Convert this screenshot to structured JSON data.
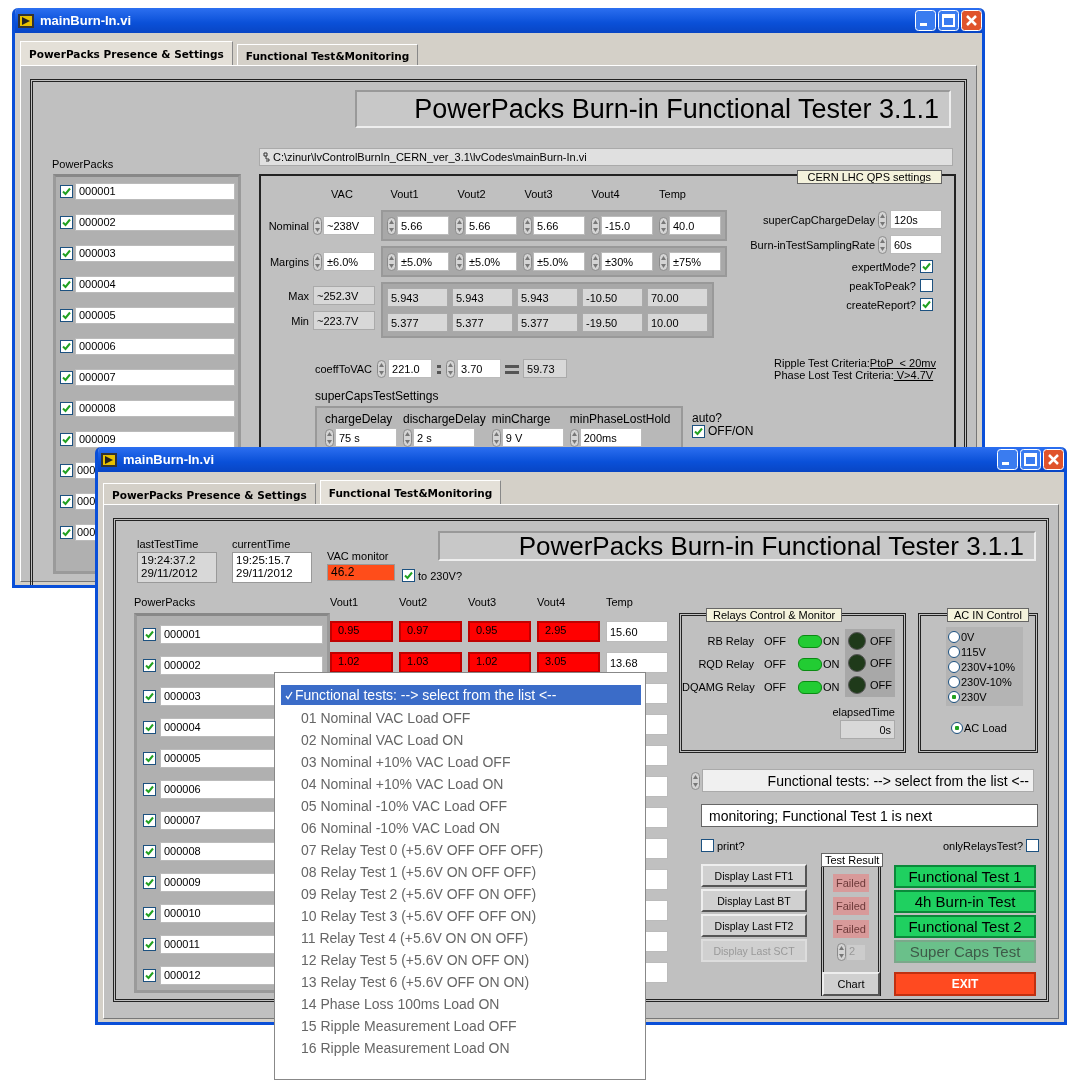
{
  "back_window": {
    "title": "mainBurn-In.vi",
    "tabs": [
      {
        "label": "PowerPacks Presence & Settings",
        "selected": true
      },
      {
        "label": "Functional Test&Monitoring",
        "selected": false
      }
    ],
    "heading": "PowerPacks Burn-in Functional Tester 3.1.1",
    "path": "C:\\zinur\\lvControlBurnIn_CERN_ver_3.1\\lvCodes\\mainBurn-In.vi",
    "powerpacks_label": "PowerPacks",
    "powerpacks": [
      {
        "id": "000001",
        "checked": true
      },
      {
        "id": "000002",
        "checked": true
      },
      {
        "id": "000003",
        "checked": true
      },
      {
        "id": "000004",
        "checked": true
      },
      {
        "id": "000005",
        "checked": true
      },
      {
        "id": "000006",
        "checked": true
      },
      {
        "id": "000007",
        "checked": true
      },
      {
        "id": "000008",
        "checked": true
      },
      {
        "id": "000009",
        "checked": true
      },
      {
        "id": "000",
        "checked": true
      },
      {
        "id": "000",
        "checked": true
      },
      {
        "id": "000",
        "checked": true
      }
    ],
    "settings_label": "CERN LHC QPS settings",
    "columns": [
      "VAC",
      "Vout1",
      "Vout2",
      "Vout3",
      "Vout4",
      "Temp"
    ],
    "input_rows": [
      {
        "label": "Nominal",
        "values": [
          "~238V",
          "5.66",
          "5.66",
          "5.66",
          "-15.0",
          "40.0"
        ]
      },
      {
        "label": "Margins",
        "values": [
          "±6.0%",
          "±5.0%",
          "±5.0%",
          "±5.0%",
          "±30%",
          "±75%"
        ]
      }
    ],
    "limit_rows": [
      {
        "label": "Max",
        "values": [
          "~252.3V",
          "5.943",
          "5.943",
          "5.943",
          "-10.50",
          "70.00"
        ]
      },
      {
        "label": "Min",
        "values": [
          "~223.7V",
          "5.377",
          "5.377",
          "5.377",
          "-19.50",
          "10.00"
        ]
      }
    ],
    "coeff": {
      "label": "coeffToVAC",
      "a": "221.0",
      "b": "3.70",
      "result": "59.73"
    },
    "supercaps": {
      "label": "superCapsTestSettings",
      "fields": [
        {
          "label": "chargeDelay",
          "value": "75 s"
        },
        {
          "label": "dischargeDelay",
          "value": "2 s"
        },
        {
          "label": "minCharge",
          "value": "9 V"
        },
        {
          "label": "minPhaseLostHold",
          "value": "200ms"
        }
      ]
    },
    "auto": {
      "label": "auto?",
      "option": "OFF/ON",
      "checked": true
    },
    "timings": [
      {
        "label": "superCapChargeDelay",
        "value": "120s"
      },
      {
        "label": "Burn-inTestSamplingRate",
        "value": "60s"
      }
    ],
    "flags": [
      {
        "label": "expertMode?",
        "checked": true
      },
      {
        "label": "peakToPeak?",
        "checked": false
      },
      {
        "label": "createReport?",
        "checked": true
      }
    ],
    "criteria": [
      {
        "label": "Ripple Test Criteria:",
        "value": "PtoP  < 20mv"
      },
      {
        "label": "Phase Lost Test Criteria:",
        "value": " V>4.7V"
      }
    ]
  },
  "front_window": {
    "title": "mainBurn-In.vi",
    "tabs": [
      {
        "label": "PowerPacks Presence & Settings",
        "selected": false
      },
      {
        "label": "Functional Test&Monitoring",
        "selected": true
      }
    ],
    "times": [
      {
        "label": "lastTestTime",
        "lines": [
          "19:24:37.2",
          "29/11/2012"
        ],
        "readonly": true
      },
      {
        "label": "currentTime",
        "lines": [
          "19:25:15.7",
          "29/11/2012"
        ],
        "readonly": false
      }
    ],
    "vac_monitor": {
      "label": "VAC monitor",
      "value": "46.2",
      "alarm": true
    },
    "to_230": {
      "label": "to 230V?",
      "checked": true
    },
    "heading": "PowerPacks Burn-in Functional Tester 3.1.1",
    "powerpacks_label": "PowerPacks",
    "columns": [
      "Vout1",
      "Vout2",
      "Vout3",
      "Vout4",
      "Temp"
    ],
    "powerpacks": [
      {
        "id": "000001",
        "checked": true,
        "alarm": true,
        "readings": [
          "0.95",
          "0.97",
          "0.95",
          "2.95"
        ],
        "temp": "15.60"
      },
      {
        "id": "000002",
        "checked": true,
        "alarm": true,
        "readings": [
          "1.02",
          "1.03",
          "1.02",
          "3.05"
        ],
        "temp": "13.68"
      },
      {
        "id": "000003",
        "checked": true
      },
      {
        "id": "000004",
        "checked": true
      },
      {
        "id": "000005",
        "checked": true
      },
      {
        "id": "000006",
        "checked": true
      },
      {
        "id": "000007",
        "checked": true
      },
      {
        "id": "000008",
        "checked": true
      },
      {
        "id": "000009",
        "checked": true
      },
      {
        "id": "000010",
        "checked": true
      },
      {
        "id": "000011",
        "checked": true
      },
      {
        "id": "000012",
        "checked": true
      }
    ],
    "relays": {
      "label": "Relays Control & Monitor",
      "items": [
        {
          "label": "RB Relay",
          "state": "OFF",
          "on": true,
          "switch_label": "ON",
          "lit": false,
          "led_label": "OFF"
        },
        {
          "label": "RQD Relay",
          "state": "OFF",
          "on": true,
          "switch_label": "ON",
          "lit": false,
          "led_label": "OFF"
        },
        {
          "label": "DQAMG Relay",
          "state": "OFF",
          "on": true,
          "switch_label": "ON",
          "lit": false,
          "led_label": "OFF"
        }
      ],
      "elapsed": {
        "label": "elapsedTime",
        "value": "0s"
      }
    },
    "ac_in": {
      "label": "AC IN Control",
      "options": [
        {
          "label": "0V",
          "selected": false
        },
        {
          "label": "115V",
          "selected": false
        },
        {
          "label": "230V+10%",
          "selected": false
        },
        {
          "label": "230V-10%",
          "selected": false
        },
        {
          "label": "230V",
          "selected": true
        }
      ],
      "load": {
        "label": "AC Load",
        "selected": true
      }
    },
    "selector": "Functional tests: --> select from the list <--",
    "status": "monitoring; Functional Test 1 is next",
    "print": {
      "label": "print?",
      "checked": false
    },
    "only_relays": {
      "label": "onlyRelaysTest?",
      "checked": false
    },
    "display_buttons": [
      {
        "label": "Display Last FT1",
        "disabled": false
      },
      {
        "label": "Display Last BT",
        "disabled": false
      },
      {
        "label": "Display Last FT2",
        "disabled": false
      },
      {
        "label": "Display Last SCT",
        "disabled": true
      }
    ],
    "test_result": {
      "label": "Test Result",
      "items": [
        {
          "label": "Failed",
          "lit": false
        },
        {
          "label": "Failed",
          "lit": false
        },
        {
          "label": "Failed",
          "lit": false
        }
      ],
      "index": "2"
    },
    "test_buttons": [
      {
        "label": "Functional Test 1",
        "disabled": false
      },
      {
        "label": "4h Burn-in Test",
        "disabled": false
      },
      {
        "label": "Functional Test 2",
        "disabled": false
      },
      {
        "label": "Super Caps Test",
        "disabled": true
      }
    ],
    "chart_button": "Chart",
    "exit_button": "EXIT"
  },
  "dropdown": {
    "items": [
      {
        "label": "Functional tests: --> select from the list <--",
        "selected": true
      },
      {
        "label": "01 Nominal VAC Load OFF",
        "selected": false
      },
      {
        "label": "02 Nominal VAC Load ON",
        "selected": false
      },
      {
        "label": "03 Nominal +10% VAC Load OFF",
        "selected": false
      },
      {
        "label": "04 Nominal +10% VAC Load ON",
        "selected": false
      },
      {
        "label": "05 Nominal -10% VAC Load OFF",
        "selected": false
      },
      {
        "label": "06 Nominal -10% VAC Load ON",
        "selected": false
      },
      {
        "label": "07 Relay Test 0 (+5.6V OFF OFF OFF)",
        "selected": false
      },
      {
        "label": "08 Relay Test 1 (+5.6V ON OFF OFF)",
        "selected": false
      },
      {
        "label": "09 Relay Test 2 (+5.6V OFF ON OFF)",
        "selected": false
      },
      {
        "label": "10 Relay Test 3 (+5.6V OFF OFF ON)",
        "selected": false
      },
      {
        "label": "11 Relay Test 4 (+5.6V ON ON OFF)",
        "selected": false
      },
      {
        "label": "12 Relay Test 5 (+5.6V ON OFF ON)",
        "selected": false
      },
      {
        "label": "13 Relay Test 6 (+5.6V OFF ON ON)",
        "selected": false
      },
      {
        "label": "14 Phase Loss 100ms Load ON",
        "selected": false
      },
      {
        "label": "15 Ripple Measurement Load OFF",
        "selected": false
      },
      {
        "label": "16 Ripple Measurement Load ON",
        "selected": false
      }
    ]
  }
}
